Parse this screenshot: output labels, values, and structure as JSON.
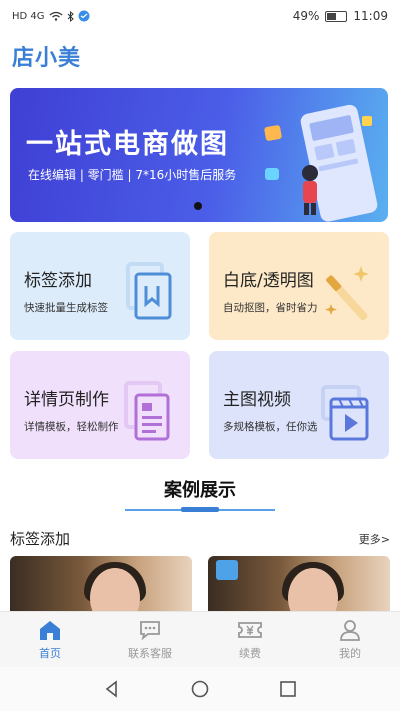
{
  "status_bar": {
    "network": "HD 4G",
    "battery": "49%",
    "battery_level": 0.49,
    "time": "11:09"
  },
  "app": {
    "logo_text": "店小美"
  },
  "banner": {
    "title": "一站式电商做图",
    "subtitle": "在线编辑 | 零门槛 | 7*16小时售后服务"
  },
  "features": [
    {
      "title": "标签添加",
      "subtitle": "快速批量生成标签",
      "icon": "bookmark-icon"
    },
    {
      "title": "白底/透明图",
      "subtitle": "自动抠图，省时省力",
      "icon": "magic-wand-icon"
    },
    {
      "title": "详情页制作",
      "subtitle": "详情模板，轻松制作",
      "icon": "document-icon"
    },
    {
      "title": "主图视频",
      "subtitle": "多规格模板，任你选",
      "icon": "video-clapper-icon"
    }
  ],
  "showcase": {
    "section_title": "案例展示",
    "list_title": "标签添加",
    "more_label": "更多>"
  },
  "tabbar": {
    "items": [
      {
        "label": "首页",
        "icon": "home-icon",
        "active": true
      },
      {
        "label": "联系客服",
        "icon": "chat-icon",
        "active": false
      },
      {
        "label": "续费",
        "icon": "ticket-icon",
        "active": false
      },
      {
        "label": "我的",
        "icon": "user-icon",
        "active": false
      }
    ]
  },
  "colors": {
    "accent": "#3a7fd6",
    "inactive": "#999999"
  }
}
